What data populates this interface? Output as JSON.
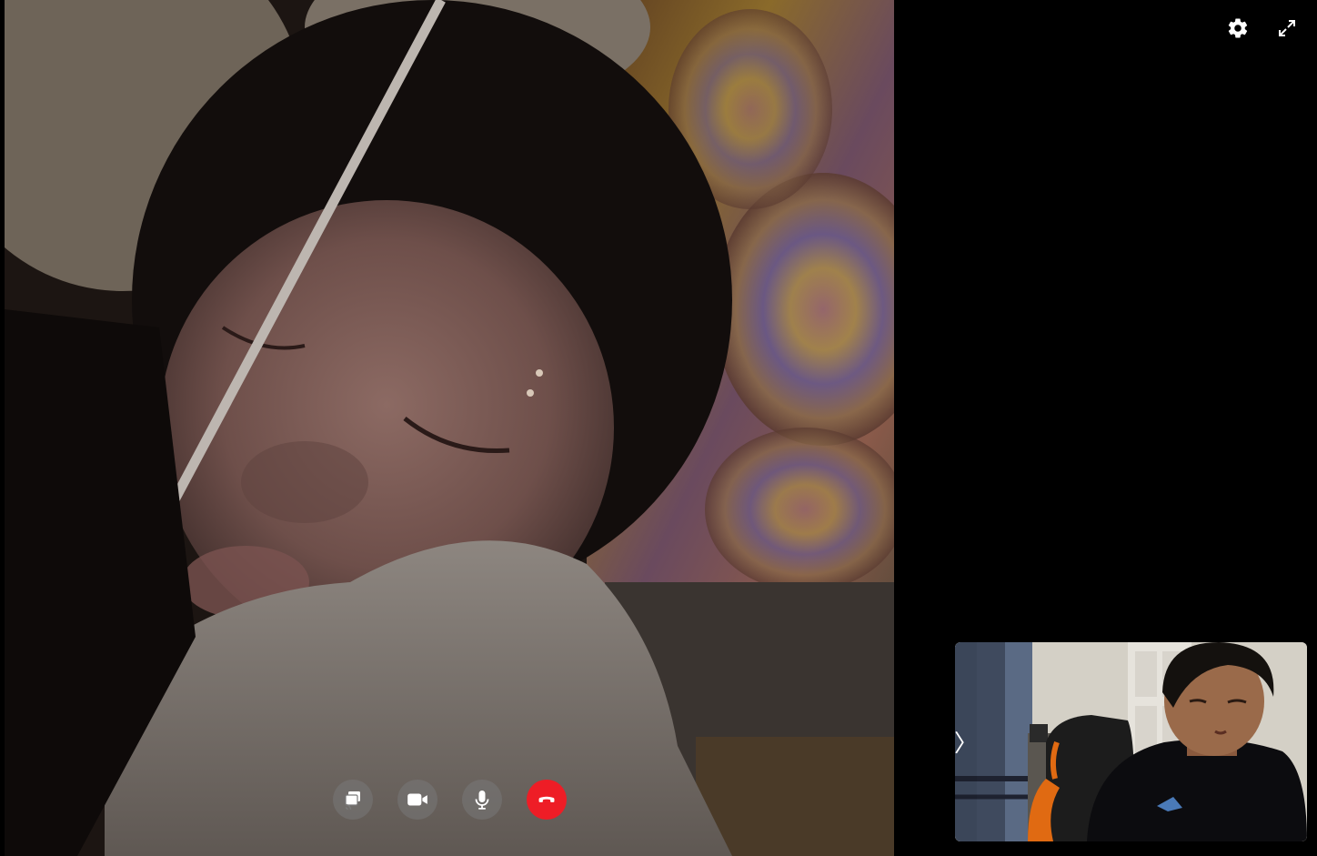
{
  "remote_video": {
    "participant": "remote-participant-video"
  },
  "top_controls": [
    {
      "icon": "gear-icon",
      "action": "settings"
    },
    {
      "icon": "fullscreen-icon",
      "action": "fullscreen"
    }
  ],
  "call_controls": [
    {
      "icon": "screen-share-icon",
      "action": "share-screen"
    },
    {
      "icon": "video-camera-icon",
      "action": "toggle-video"
    },
    {
      "icon": "microphone-icon",
      "action": "toggle-mic"
    },
    {
      "icon": "end-call-icon",
      "action": "hang-up"
    }
  ],
  "self_view": {
    "collapse_glyph": "〉"
  },
  "colors": {
    "background": "#000000",
    "end_call": "#ee1d26",
    "control_bg": "rgba(120,120,120,0.55)",
    "icon": "#ffffff"
  }
}
